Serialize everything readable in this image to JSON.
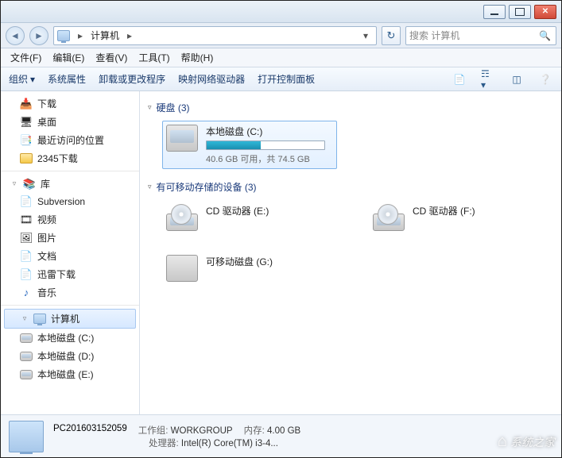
{
  "breadcrumb": {
    "root": "计算机",
    "sep": "▸"
  },
  "search": {
    "placeholder": "搜索 计算机"
  },
  "menu": {
    "file": "文件(F)",
    "edit": "编辑(E)",
    "view": "查看(V)",
    "tools": "工具(T)",
    "help": "帮助(H)"
  },
  "toolbar": {
    "organize": "组织",
    "sys_props": "系统属性",
    "uninstall": "卸载或更改程序",
    "map_net": "映射网络驱动器",
    "control_panel": "打开控制面板"
  },
  "sidebar": {
    "downloads": "下载",
    "desktop": "桌面",
    "recent": "最近访问的位置",
    "folder2345": "2345下载",
    "libraries": "库",
    "subversion": "Subversion",
    "videos": "视频",
    "pictures": "图片",
    "documents": "文档",
    "xunlei": "迅雷下载",
    "music": "音乐",
    "computer": "计算机",
    "local_c": "本地磁盘 (C:)",
    "local_d": "本地磁盘 (D:)",
    "local_e": "本地磁盘 (E:)"
  },
  "main": {
    "hdd_group": "硬盘 (3)",
    "removable_group": "有可移动存储的设备 (3)",
    "drive_c": {
      "label": "本地磁盘 (C:)",
      "free": "40.6 GB 可用，共 74.5 GB",
      "used_pct": 46
    },
    "cd_e": "CD 驱动器 (E:)",
    "cd_f": "CD 驱动器 (F:)",
    "rem_g": "可移动磁盘 (G:)"
  },
  "details": {
    "name": "PC201603152059",
    "workgroup_label": "工作组:",
    "workgroup": "WORKGROUP",
    "mem_label": "内存:",
    "mem": "4.00 GB",
    "cpu_label": "处理器:",
    "cpu": "Intel(R) Core(TM) i3-4..."
  },
  "watermark": "系统之家"
}
